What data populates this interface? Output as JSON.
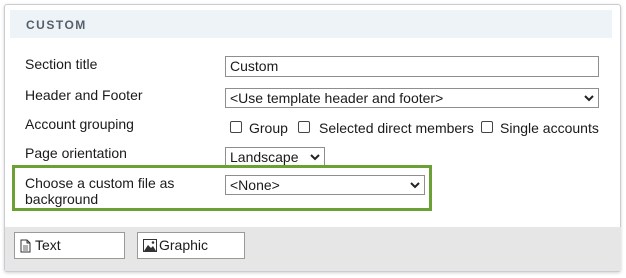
{
  "header": {
    "title": "CUSTOM"
  },
  "form": {
    "section_title": {
      "label": "Section title",
      "value": "Custom"
    },
    "header_footer": {
      "label": "Header and Footer",
      "value": "<Use template header and footer>"
    },
    "account_grouping": {
      "label": "Account grouping",
      "options": [
        {
          "label": "Group",
          "checked": false
        },
        {
          "label": "Selected direct members",
          "checked": false
        },
        {
          "label": "Single accounts",
          "checked": false
        }
      ]
    },
    "page_orientation": {
      "label": "Page orientation",
      "value": "Landscape"
    },
    "custom_file": {
      "label_line1": "Choose a custom file as",
      "label_line2": "background",
      "value": "<None>"
    }
  },
  "footer": {
    "text_button": {
      "label": "Text",
      "icon": "document-icon"
    },
    "graphic_button": {
      "label": "Graphic",
      "icon": "image-icon"
    }
  },
  "colors": {
    "highlight_border": "#6aa034",
    "header_bg": "#eef3f8",
    "footer_bg": "#e6e6e6"
  }
}
